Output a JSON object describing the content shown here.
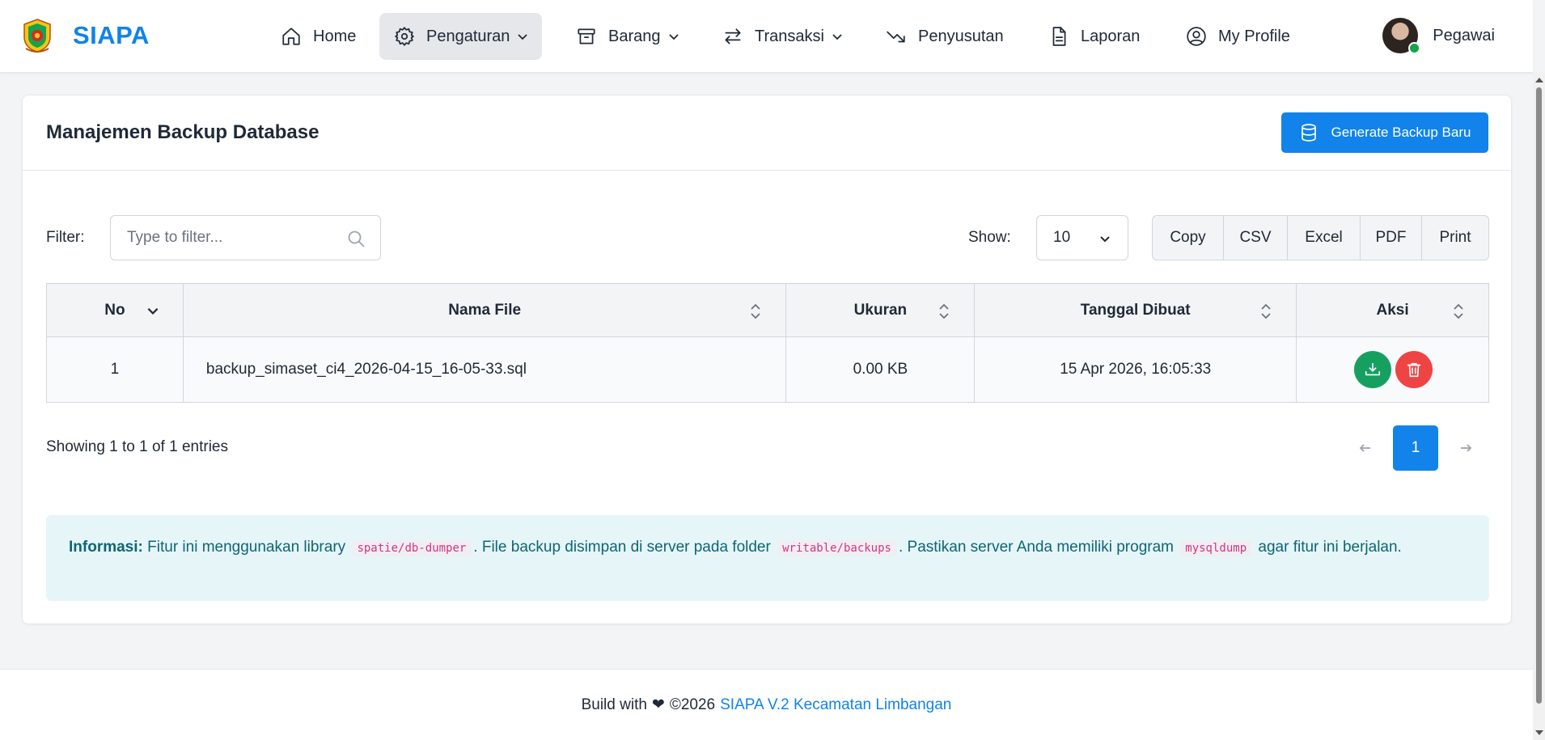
{
  "brand": {
    "name": "SIAPA"
  },
  "nav": {
    "items": [
      {
        "label": "Home",
        "icon": "home-icon"
      },
      {
        "label": "Pengaturan",
        "icon": "gear-icon",
        "active": true,
        "dropdown": true
      },
      {
        "label": "Barang",
        "icon": "archive-icon",
        "dropdown": true
      },
      {
        "label": "Transaksi",
        "icon": "arrows-swap-icon",
        "dropdown": true
      },
      {
        "label": "Penyusutan",
        "icon": "trending-down-icon"
      },
      {
        "label": "Laporan",
        "icon": "document-icon"
      },
      {
        "label": "My Profile",
        "icon": "user-circle-icon"
      }
    ],
    "user": {
      "name": "Pegawai",
      "status": "online"
    }
  },
  "card": {
    "title": "Manajemen Backup Database",
    "generate_label": "Generate Backup Baru"
  },
  "controls": {
    "filter_label": "Filter:",
    "filter_placeholder": "Type to filter...",
    "show_label": "Show:",
    "show_value": "10",
    "export_buttons": [
      "Copy",
      "CSV",
      "Excel",
      "PDF",
      "Print"
    ]
  },
  "table": {
    "columns": [
      "No",
      "Nama File",
      "Ukuran",
      "Tanggal Dibuat",
      "Aksi"
    ],
    "rows": [
      {
        "no": "1",
        "file": "backup_simaset_ci4_2026-04-15_16-05-33.sql",
        "size": "0.00 KB",
        "date": "15 Apr 2026, 16:05:33"
      }
    ]
  },
  "pagination": {
    "info": "Showing 1 to 1 of 1 entries",
    "current_page": "1"
  },
  "alert": {
    "title": "Informasi:",
    "text_1": "Fitur ini menggunakan library",
    "code_1": "spatie/db-dumper",
    "text_2": ". File backup disimpan di server pada folder",
    "code_2": "writable/backups",
    "text_3": ". Pastikan server Anda memiliki program",
    "code_3": "mysqldump",
    "text_4": "agar fitur ini berjalan."
  },
  "footer": {
    "text": "Build with",
    "year": "©2026",
    "link": "SIAPA V.2 Kecamatan Limbangan"
  },
  "colors": {
    "primary": "#1183ea",
    "success": "#16a060",
    "danger": "#ef4444",
    "info_bg": "#e6f5f8",
    "info_text": "#0e6674"
  }
}
